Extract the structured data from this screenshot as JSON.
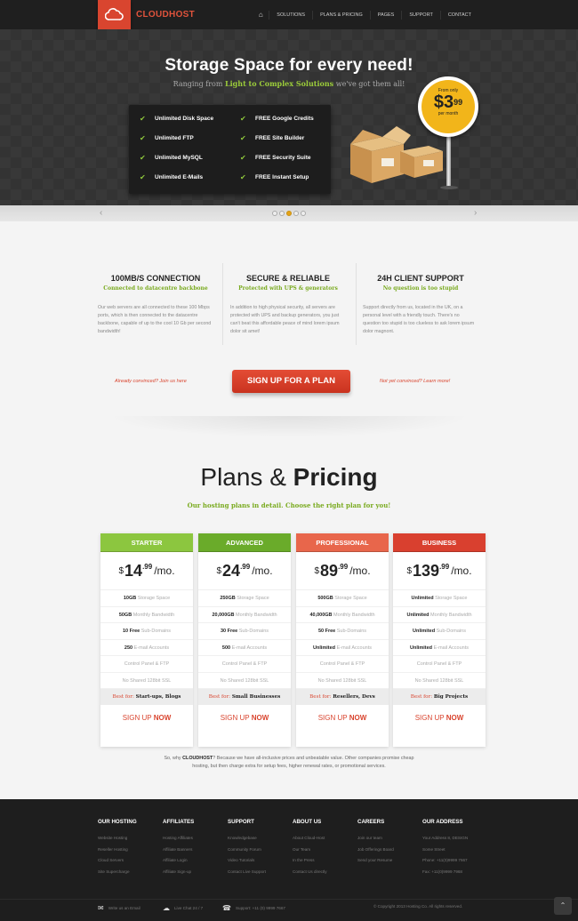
{
  "brand": {
    "name": "CLOUDHOST"
  },
  "nav": {
    "items": [
      "SOLUTIONS",
      "PLANS & PRICING",
      "PAGES",
      "SUPPORT",
      "CONTACT"
    ]
  },
  "hero": {
    "title": "Storage Space for every need!",
    "sub_pre": "Ranging from ",
    "sub_hl": "Light to Complex Solutions",
    "sub_post": " we've got them all!",
    "features_left": [
      "Unlimited Disk Space",
      "Unlimited FTP",
      "Unlimited MySQL",
      "Unlimited E-Mails"
    ],
    "features_right": [
      "FREE Google Credits",
      "FREE Site Builder",
      "FREE Security Suite",
      "FREE Instant Setup"
    ],
    "price_label": "From only",
    "price_int": "$3",
    "price_cents": "99",
    "price_per": "per month",
    "slider_active": 3
  },
  "highlights": [
    {
      "title": "100MB/S CONNECTION",
      "subtitle": "Connected to datacentre backbone",
      "text": "Our web servers are all connected to these 100 Mbps ports, which is then connected to the datacentre backbone, capable of up to the cool 10 Gb per second bandwidth!"
    },
    {
      "title": "SECURE & RELIABLE",
      "subtitle": "Protected with UPS & generators",
      "text": "In addition to high physical security, all servers are protected with UPS and backup generators, you just can't beat this affordable peace of mind lorem ipsum dolor sit amet!"
    },
    {
      "title": "24H CLIENT SUPPORT",
      "subtitle": "No question is too stupid",
      "text": "Support directly from us, located in the UK, on a personal level with a friendly touch. There's no question too stupid is too clueless to ask lorem ipsum dolor magnont."
    }
  ],
  "cta": {
    "left": "Already convinced? Join us here",
    "button": "SIGN UP FOR A PLAN",
    "right": "Not yet convinced? Learn more!"
  },
  "pricing": {
    "title_light": "Plans &",
    "title_bold": "Pricing",
    "subtitle": "Our hosting plans in detail. Choose the right plan for you!",
    "plans": [
      {
        "name": "STARTER",
        "color": "#8cc63f",
        "currency": "$",
        "price": "14",
        "cents": ".99",
        "per": "/mo.",
        "rows": [
          [
            "10GB",
            " Storage Space"
          ],
          [
            "50GB",
            " Monthly Bandwidth"
          ],
          [
            "10 Free",
            " Sub-Domains"
          ],
          [
            "250",
            " E-mail Accounts"
          ],
          [
            "",
            "Control Panel & FTP"
          ],
          [
            "",
            "No Shared 128bit SSL"
          ]
        ],
        "best_label": "Best for:",
        "best_for": "Start-ups, Blogs",
        "signup": "SIGN UP",
        "signup_b": "NOW"
      },
      {
        "name": "ADVANCED",
        "color": "#6aab2a",
        "currency": "$",
        "price": "24",
        "cents": ".99",
        "per": "/mo.",
        "rows": [
          [
            "250GB",
            " Storage Space"
          ],
          [
            "20,000GB",
            " Monthly Bandwidth"
          ],
          [
            "30 Free",
            " Sub-Domains"
          ],
          [
            "500",
            " E-mail Accounts"
          ],
          [
            "",
            "Control Panel & FTP"
          ],
          [
            "",
            "No Shared 128bit SSL"
          ]
        ],
        "best_label": "Best for:",
        "best_for": "Small Businesses",
        "signup": "SIGN UP",
        "signup_b": "NOW"
      },
      {
        "name": "PROFESSIONAL",
        "color": "#e8664b",
        "currency": "$",
        "price": "89",
        "cents": ".99",
        "per": "/mo.",
        "rows": [
          [
            "500GB",
            " Storage Space"
          ],
          [
            "40,000GB",
            " Monthly Bandwidth"
          ],
          [
            "50 Free",
            " Sub-Domains"
          ],
          [
            "Unlimited",
            " E-mail Accounts"
          ],
          [
            "",
            "Control Panel & FTP"
          ],
          [
            "",
            "No Shared 128bit SSL"
          ]
        ],
        "best_label": "Best for:",
        "best_for": "Resellers, Devs",
        "signup": "SIGN UP",
        "signup_b": "NOW"
      },
      {
        "name": "BUSINESS",
        "color": "#d9402f",
        "currency": "$",
        "price": "139",
        "cents": ".99",
        "per": "/mo.",
        "rows": [
          [
            "Unlimited",
            " Storage Space"
          ],
          [
            "Unlimited",
            " Monthly Bandwidth"
          ],
          [
            "Unlimited",
            " Sub-Domains"
          ],
          [
            "Unlimited",
            " E-mail Accounts"
          ],
          [
            "",
            "Control Panel & FTP"
          ],
          [
            "",
            "No Shared 128bit SSL"
          ]
        ],
        "best_label": "Best for:",
        "best_for": "Big Projects",
        "signup": "SIGN UP",
        "signup_b": "NOW"
      }
    ],
    "why_pre": "So, why ",
    "why_brand": "CLOUDHOST",
    "why_post": "? Because we have all-inclusive prices and unbeatable value. Other companies promise cheap hosting, but then charge extra for setup fees, higher renewal rates, or promotional services."
  },
  "footer": {
    "columns": [
      {
        "heading": "OUR HOSTING",
        "links": [
          "Website Hosting",
          "Reseller Hosting",
          "Cloud Servers",
          "Site Supercharge"
        ]
      },
      {
        "heading": "AFFILIATES",
        "links": [
          "Hosting Affiliates",
          "Affiliate Banners",
          "Affiliate Login",
          "Affiliate Sign-up"
        ]
      },
      {
        "heading": "SUPPORT",
        "links": [
          "Knowledgebase",
          "Community Forum",
          "Video Tutorials",
          "Contact Live Support"
        ]
      },
      {
        "heading": "ABOUT US",
        "links": [
          "About Cloud-Host",
          "Our Team",
          "In the Press",
          "Contact Us directly"
        ]
      },
      {
        "heading": "CAREERS",
        "links": [
          "Join our team",
          "Job Offerings Board",
          "Send your Resume"
        ]
      },
      {
        "heading": "OUR ADDRESS",
        "links": [
          "Your Address 8, DESIGN",
          "Some Street",
          "Phone: +11(0)9999 7667",
          "Fax: +11(0)9999 7968"
        ]
      }
    ],
    "bottom": [
      {
        "icon": "mail-icon",
        "glyph": "✉",
        "label": "Write us an Email"
      },
      {
        "icon": "chat-icon",
        "glyph": "☁",
        "label": "Live Chat 24 / 7"
      },
      {
        "icon": "headset-icon",
        "glyph": "☎",
        "label": "Support: +11 (0) 9999 7667"
      }
    ],
    "copyright": "© Copyright 2013 Hosting Co. All rights reserved."
  }
}
